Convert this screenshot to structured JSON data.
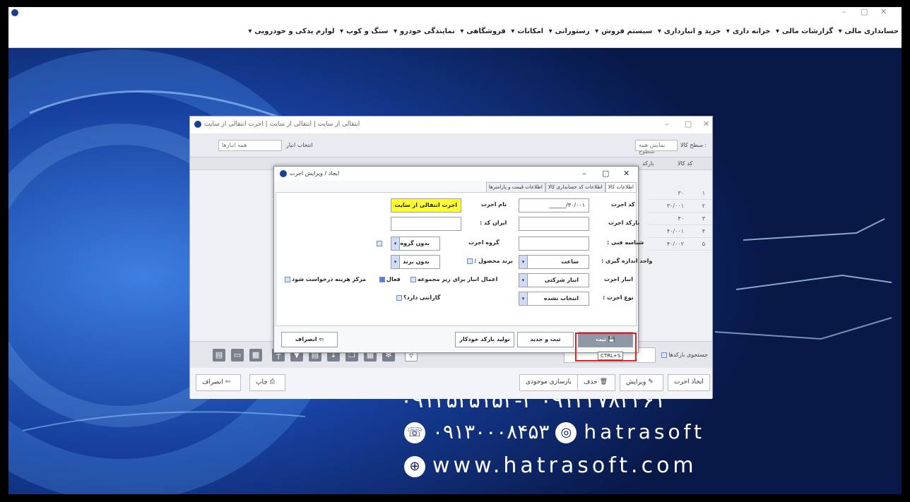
{
  "menubar": {
    "items": [
      "حسابداری مالی",
      "گزارشات مالی",
      "خزانه داری",
      "خرید و انبارداری",
      "سیستم فروش",
      "رستورانی",
      "امکانات",
      "فروشگاهی",
      "نمایندگی خودرو",
      "سنگ و کوپ",
      "لوازم یدکی و خودرویی"
    ],
    "minimize": "–",
    "maximize": "▢",
    "close": "✕"
  },
  "branding": {
    "phone_partial": "۰۹۱۲۵۲۵۱۵۲-۳  ۰۹۱۲۳۷۸۳۴۶۱",
    "mobile": "۰۹۱۳۰۰۰۸۴۵۳",
    "instagram": "hatrasoft",
    "website": "www.hatrasoft.com"
  },
  "main_window": {
    "title": "انتقالی از سایت | انتقالی از سایت | اجرت انتقالی از سایت",
    "warehouse_label": "انتخاب انبار",
    "warehouse_value": "همه انبارها",
    "level_label": "سطح کالا :",
    "level_value": "نمایش همه سطوح",
    "columns": [
      "کد کالا",
      "بارکد"
    ],
    "rows": [
      {
        "num": "۱",
        "code": "۳۰"
      },
      {
        "num": "۲",
        "code": "۳۰/۰۰۱"
      },
      {
        "num": "۳",
        "code": "۴۰"
      },
      {
        "num": "۴",
        "code": "۴۰/۰۰۱"
      },
      {
        "num": "۵",
        "code": "۴۰/۰۰۲"
      }
    ],
    "barcode_search_label": "جستجوی بارکدها",
    "buttons": {
      "create": "ایجاد اجرت",
      "edit": "ویرایش",
      "delete": "حذف",
      "stock": "بازسازی موجودی",
      "print": "چاپ",
      "cancel": "انصراف"
    }
  },
  "dialog": {
    "title": "ایجاد / ویرایش اجرت",
    "tabs": [
      "اطلاعات کالا",
      "اطلاعات کد حسابداری کالا",
      "اطلاعات قیمت و پارامترها"
    ],
    "fields": {
      "code_label": "کد اجرت",
      "code_value": "۳۰/۰۰۱/______",
      "name_label": "نام اجرت",
      "name_value": "اجرت انتقالی از سایت",
      "barcode_label": "بارکد اجرت",
      "barcode_value": "",
      "iran_code_label": "ایران کد :",
      "iran_code_value": "",
      "tech_id_label": "شناسه فنی :",
      "tech_id_value": "",
      "group_label": "گروه اجرت",
      "group_value": "بدون گروه",
      "unit_label": "واحد اندازه گیری :",
      "unit_value": "ساعت",
      "brand_label": "برند محصول :",
      "brand_value": "بدون برند",
      "warehouse_label": "انبار اجرت",
      "warehouse_value": "انبار شرکتی",
      "apply_sub_label": "اعمال انبار برای زیر مجموعه",
      "active_label": "فعال",
      "cost_center_label": "مرکز هزینه درخواست شود",
      "type_label": "نوع اجرت :",
      "type_value": "انتخاب نشده",
      "warranty_label": "گارانتی دارد؟"
    },
    "buttons": {
      "submit": "ثبت",
      "submit_new": "ثبت و جدید",
      "gen_barcode": "تولید بارکد خودکار",
      "cancel": "انصراف"
    },
    "tooltip": "CTRL+S"
  }
}
